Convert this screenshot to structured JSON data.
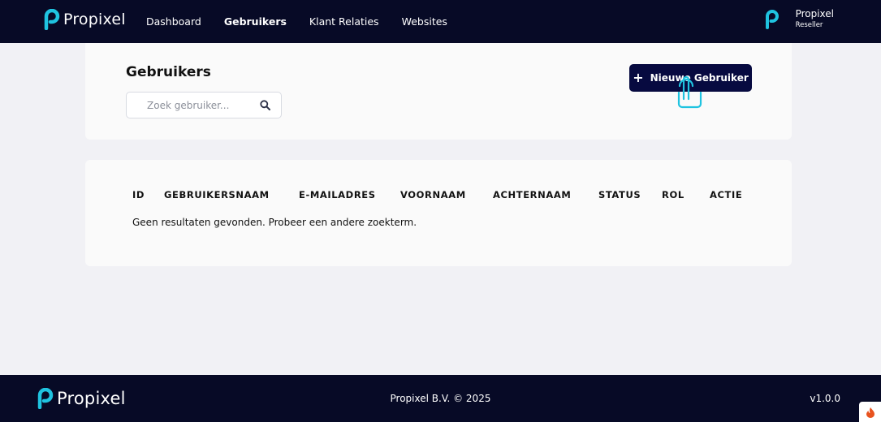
{
  "header": {
    "brand": "Propixel",
    "nav": [
      {
        "label": "Dashboard",
        "active": false
      },
      {
        "label": "Gebruikers",
        "active": true
      },
      {
        "label": "Klant Relaties",
        "active": false
      },
      {
        "label": "Websites",
        "active": false
      }
    ],
    "user": {
      "name": "Propixel",
      "role": "Reseller"
    }
  },
  "main": {
    "title": "Gebruikers",
    "search": {
      "placeholder": "Zoek gebruiker...",
      "value": ""
    },
    "new_button": {
      "label": "Nieuwe Gebruiker"
    },
    "table": {
      "columns": [
        "ID",
        "GEBRUIKERSNAAM",
        "E-MAILADRES",
        "VOORNAAM",
        "ACHTERNAAM",
        "STATUS",
        "ROL",
        "ACTIE"
      ],
      "empty_message": "Geen resultaten gevonden. Probeer een andere zoekterm."
    }
  },
  "footer": {
    "brand": "Propixel",
    "copyright": "Propixel B.V. © 2025",
    "version": "v1.0.0"
  },
  "colors": {
    "navy": "#070a26",
    "button": "#070a40",
    "accent": "#1fc3e0"
  }
}
